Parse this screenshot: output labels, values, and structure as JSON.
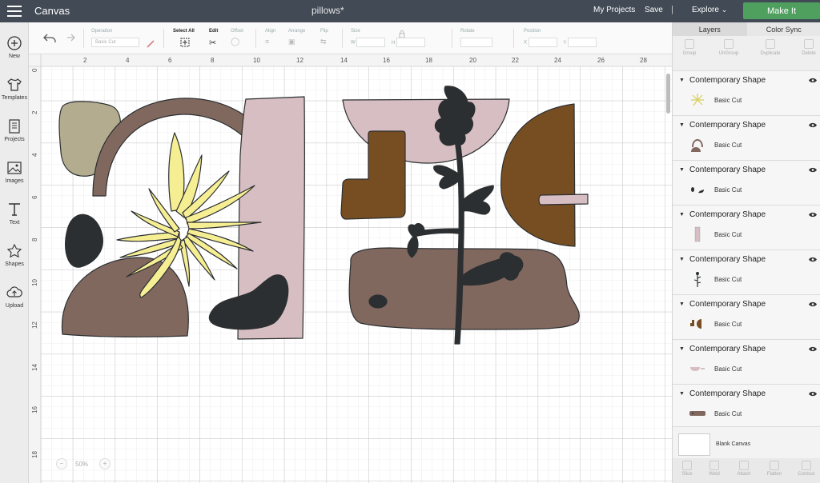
{
  "header": {
    "app_name": "Canvas",
    "project_name": "pillows*",
    "my_projects": "My Projects",
    "save": "Save",
    "explore": "Explore",
    "make_it": "Make It"
  },
  "sidebar": {
    "items": [
      {
        "label": "New",
        "icon": "plus-icon"
      },
      {
        "label": "Templates",
        "icon": "tshirt-icon"
      },
      {
        "label": "Projects",
        "icon": "projects-icon"
      },
      {
        "label": "Images",
        "icon": "image-icon"
      },
      {
        "label": "Text",
        "icon": "text-icon"
      },
      {
        "label": "Shapes",
        "icon": "shapes-icon"
      },
      {
        "label": "Upload",
        "icon": "upload-icon"
      }
    ]
  },
  "toolbar": {
    "operation_label": "Operation",
    "operation_value": "Basic Cut",
    "select_all": "Select All",
    "edit": "Edit",
    "offset": "Offset",
    "align": "Align",
    "arrange": "Arrange",
    "flip": "Flip",
    "size": "Size",
    "size_w": "W",
    "size_h": "H",
    "rotate": "Rotate",
    "position": "Position",
    "pos_x": "X",
    "pos_y": "Y"
  },
  "ruler": {
    "top": [
      "2",
      "4",
      "6",
      "8",
      "10",
      "12",
      "14",
      "16",
      "18",
      "20",
      "22",
      "24",
      "26",
      "28"
    ],
    "left": [
      "0",
      "2",
      "4",
      "6",
      "8",
      "10",
      "12",
      "14",
      "16",
      "18"
    ]
  },
  "zoom": {
    "value": "50%",
    "minus": "−",
    "plus": "+"
  },
  "panel": {
    "tabs": [
      "Layers",
      "Color Sync"
    ],
    "actions": [
      "Group",
      "UnGroup",
      "Duplicate",
      "Delete"
    ],
    "layers": [
      {
        "title": "Contemporary Shape",
        "op": "Basic Cut",
        "thumb": "leaf"
      },
      {
        "title": "Contemporary Shape",
        "op": "Basic Cut",
        "thumb": "arch"
      },
      {
        "title": "Contemporary Shape",
        "op": "Basic Cut",
        "thumb": "dots"
      },
      {
        "title": "Contemporary Shape",
        "op": "Basic Cut",
        "thumb": "rect"
      },
      {
        "title": "Contemporary Shape",
        "op": "Basic Cut",
        "thumb": "plant"
      },
      {
        "title": "Contemporary Shape",
        "op": "Basic Cut",
        "thumb": "boot"
      },
      {
        "title": "Contemporary Shape",
        "op": "Basic Cut",
        "thumb": "bowl"
      },
      {
        "title": "Contemporary Shape",
        "op": "Basic Cut",
        "thumb": "slab"
      }
    ],
    "blank_canvas": "Blank Canvas",
    "bottom_actions": [
      "Slice",
      "Weld",
      "Attach",
      "Flatten",
      "Contour"
    ]
  },
  "colors": {
    "header": "#414a55",
    "make_it": "#4fa05f",
    "tan": "#b3ac8f",
    "mauve": "#80685f",
    "pink": "#d7bec2",
    "yellow": "#f6ee93",
    "charcoal": "#2c2f31",
    "brown": "#774e22"
  }
}
